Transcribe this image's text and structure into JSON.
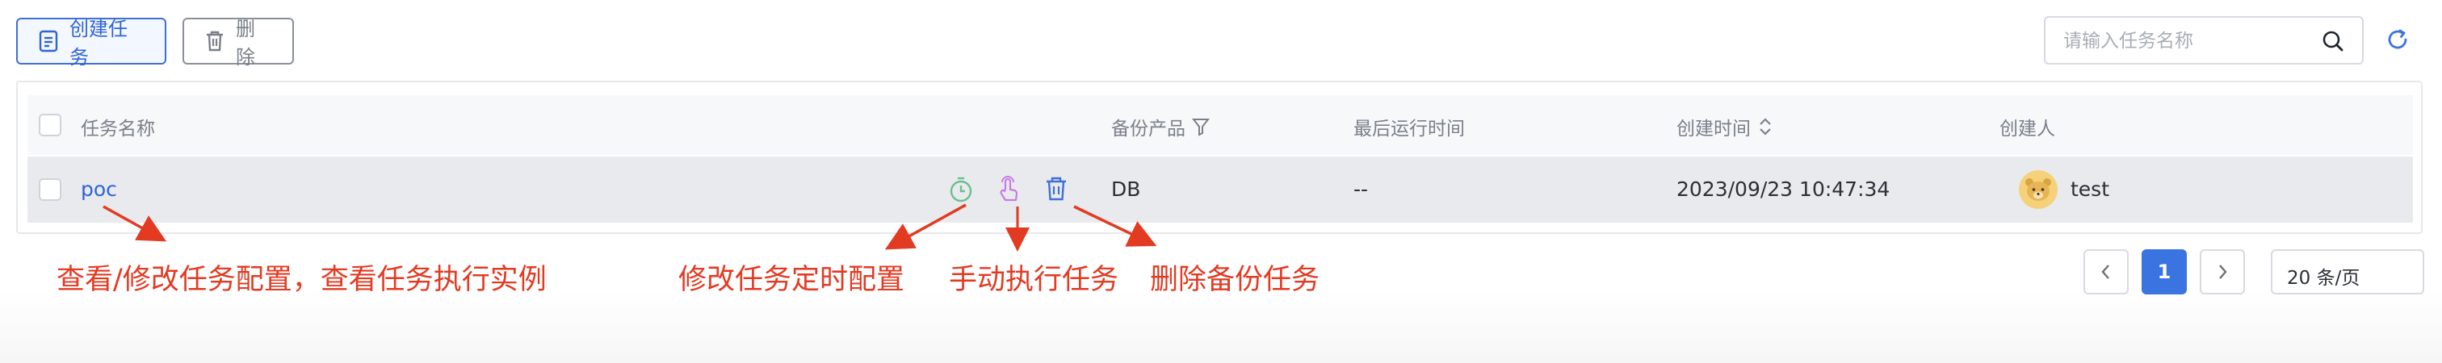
{
  "toolbar": {
    "create_label": "创建任务",
    "delete_label": "删除",
    "search_placeholder": "请输入任务名称"
  },
  "table": {
    "columns": {
      "name": "任务名称",
      "product": "备份产品",
      "last_run": "最后运行时间",
      "created": "创建时间",
      "creator": "创建人"
    },
    "rows": [
      {
        "name": "poc",
        "product": "DB",
        "last_run": "--",
        "created": "2023/09/23 10:47:34",
        "creator": "test"
      }
    ]
  },
  "pagination": {
    "current_page": "1",
    "page_size": "20 条/页"
  },
  "annotations": {
    "view": "查看/修改任务配置，查看任务执行实例",
    "schedule": "修改任务定时配置",
    "run": "手动执行任务",
    "delete": "删除备份任务"
  },
  "colors": {
    "primary": "#2f63d6",
    "annotation": "#e33a22",
    "schedule_icon": "#6bbf8e",
    "run_icon": "#c77be6",
    "delete_icon": "#3f6fd8"
  },
  "icons": {
    "create": "document-icon",
    "delete": "trash-icon",
    "search": "search-icon",
    "refresh": "refresh-icon",
    "product_filter": "filter-icon",
    "created_sort": "sort-icon",
    "row_schedule": "timer-icon",
    "row_run": "tap-icon",
    "row_delete": "trash-icon",
    "avatar": "bear-avatar"
  }
}
